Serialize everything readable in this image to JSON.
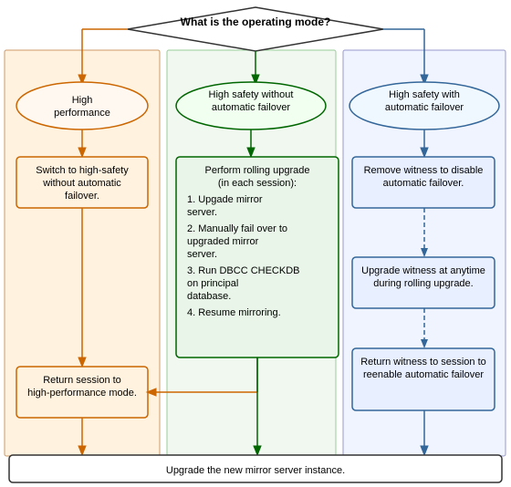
{
  "diagram": {
    "title": "What is the operating mode?",
    "nodes": {
      "diamond": "What is the operating mode?",
      "oval1": "High performance",
      "oval2": "High safety without automatic failover",
      "oval3": "High safety with automatic failover",
      "box1": "Switch to high-safety without automatic failover.",
      "box2": "Perform rolling upgrade (in each session):",
      "box2_items": [
        "1. Upgade mirror server.",
        "2. Manually fail over to upgraded mirror server.",
        "3. Run DBCC CHECKDB on principal database.",
        "4. Resume mirroring."
      ],
      "box3": "Remove witness to disable automatic failover.",
      "box4": "Return session to high-performance mode.",
      "box5": "Upgrade witness at anytime during rolling upgrade.",
      "box6": "Return witness to session to reenable automatic failover",
      "bottom": "Upgrade the new mirror server instance."
    }
  }
}
